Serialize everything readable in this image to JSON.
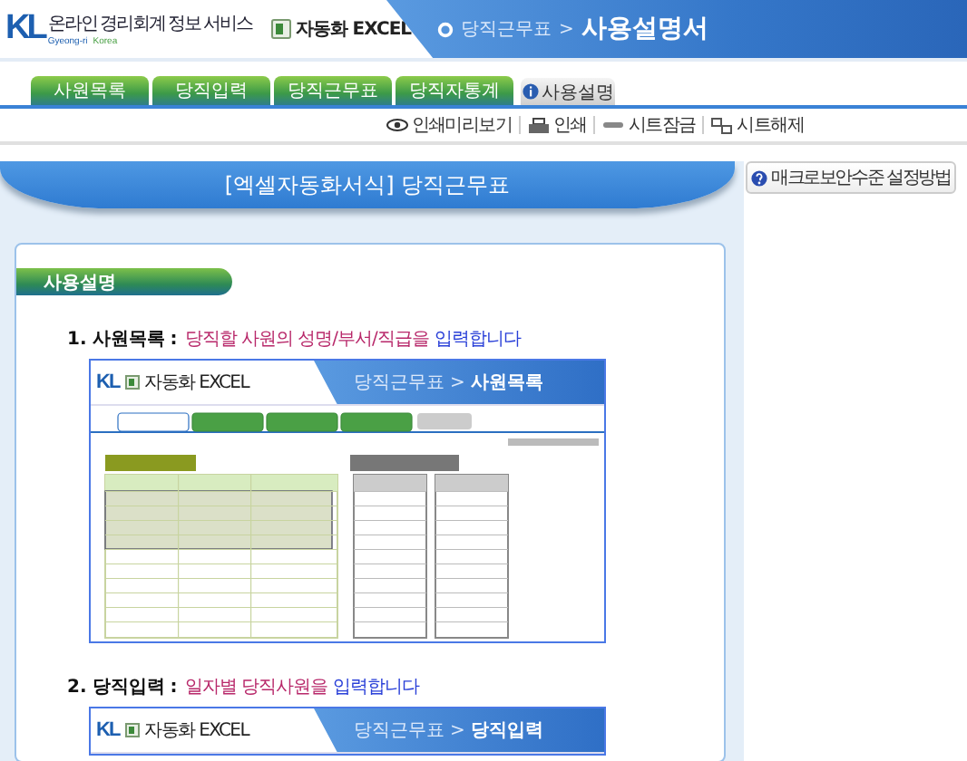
{
  "header": {
    "logo": {
      "brand": "KL",
      "service": "온라인 경리회계 정보 서비스",
      "sub_left": "Gyeong-ri",
      "sub_right": "Korea"
    },
    "product": "자동화 EXCEL",
    "breadcrumb": {
      "section": "당직근무표",
      "separator": ">",
      "page": "사용설명서"
    }
  },
  "tabs": [
    {
      "label": "사원목록",
      "selected": false,
      "kind": "plain"
    },
    {
      "label": "당직입력",
      "selected": false,
      "kind": "plain"
    },
    {
      "label": "당직근무표",
      "selected": false,
      "kind": "plain"
    },
    {
      "label": "당직자통계",
      "selected": false,
      "kind": "plain"
    },
    {
      "label": "사용설명",
      "selected": true,
      "kind": "info"
    }
  ],
  "toolbar": [
    {
      "label": "인쇄미리보기",
      "kind": "preview"
    },
    {
      "label": "인쇄",
      "kind": "print"
    },
    {
      "label": "시트잠금",
      "kind": "lock"
    },
    {
      "label": "시트해제",
      "kind": "unlock"
    }
  ],
  "banner": {
    "title": "[엑셀자동화서식] 당직근무표"
  },
  "side_button": {
    "label": "매크로보안수준 설정방법"
  },
  "section_title": "사용설명",
  "steps": [
    {
      "number": "1.",
      "title": "사원목록",
      "separator": ":",
      "segments": [
        {
          "text": "당직할 사원의 성명/부서/직급을",
          "kind": "highlight"
        },
        {
          "text": "입력합니다",
          "kind": "action"
        }
      ],
      "screenshot": {
        "brand": "KL",
        "product": "자동화 EXCEL",
        "section": "당직근무표",
        "separator": ">",
        "page": "사원목록",
        "kind": "full"
      }
    },
    {
      "number": "2.",
      "title": "당직입력",
      "separator": ":",
      "segments": [
        {
          "text": "일자별 당직사원을",
          "kind": "highlight"
        },
        {
          "text": "입력합니다",
          "kind": "action"
        }
      ],
      "screenshot": {
        "brand": "KL",
        "product": "자동화 EXCEL",
        "section": "당직근무표",
        "separator": ">",
        "page": "당직입력",
        "kind": "header_only"
      }
    }
  ]
}
